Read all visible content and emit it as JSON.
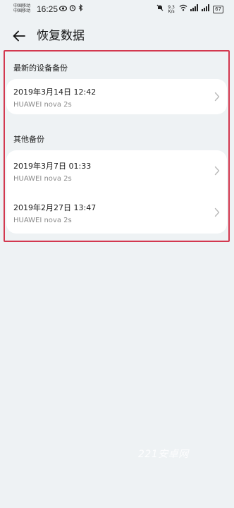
{
  "status_bar": {
    "carrier_1": "中国移动",
    "carrier_2": "中国移动",
    "time": "16:25",
    "net_speed_value": "9.3",
    "net_speed_unit": "K/s",
    "battery": "67"
  },
  "header": {
    "title": "恢复数据"
  },
  "sections": [
    {
      "title": "最新的设备备份",
      "items": [
        {
          "date": "2019年3月14日 12:42",
          "device": "HUAWEI nova 2s"
        }
      ]
    },
    {
      "title": "其他备份",
      "items": [
        {
          "date": "2019年3月7日 01:33",
          "device": "HUAWEI nova 2s"
        },
        {
          "date": "2019年2月27日 13:47",
          "device": "HUAWEI nova 2s"
        }
      ]
    }
  ],
  "watermark": "221安卓网",
  "colors": {
    "background": "#eef2f4",
    "card": "#ffffff",
    "highlight": "#d3384f",
    "secondary_text": "#8a8a8a"
  },
  "icons": [
    "back-arrow-icon",
    "chevron-right-icon",
    "eye-icon",
    "alarm-icon",
    "bluetooth-icon",
    "mute-icon",
    "wifi-icon",
    "signal-icon",
    "battery-icon"
  ]
}
